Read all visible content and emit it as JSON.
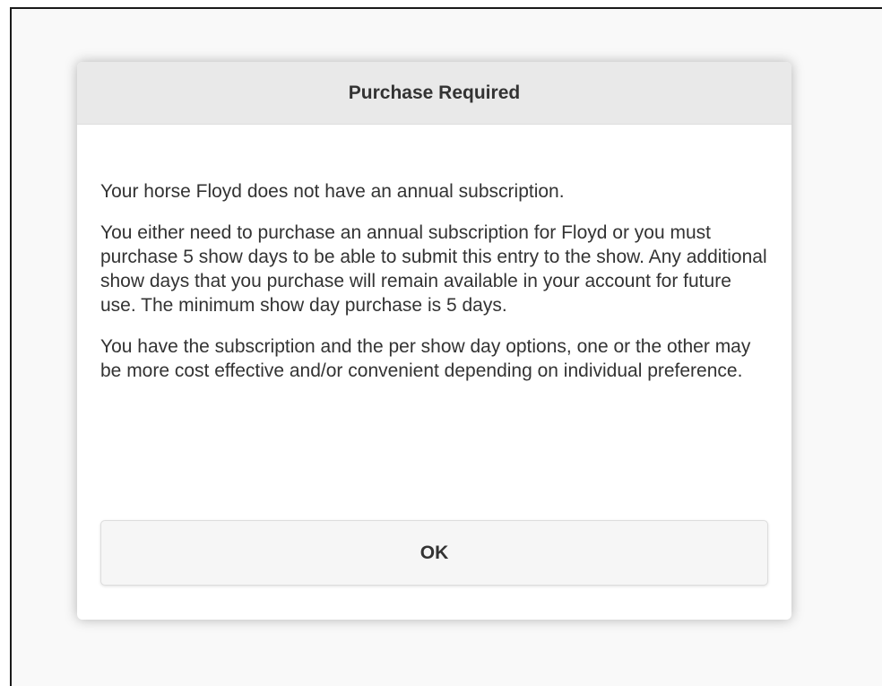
{
  "dialog": {
    "title": "Purchase Required",
    "paragraphs": [
      "Your horse Floyd does not have an annual subscription.",
      "You either need to purchase an annual subscription for Floyd or you must purchase 5 show days to be able to submit this entry to the show. Any additional show days that you purchase will remain available in your account for future use. The minimum show day purchase is 5 days.",
      "You have the subscription and the per show day options, one or the other may be more cost effective and/or convenient depending on individual preference."
    ],
    "ok_label": "OK"
  },
  "colors": {
    "header_bg": "#e9e9e9",
    "page_bg": "#f9f9f9",
    "text": "#333333",
    "button_bg": "#f6f6f6"
  }
}
